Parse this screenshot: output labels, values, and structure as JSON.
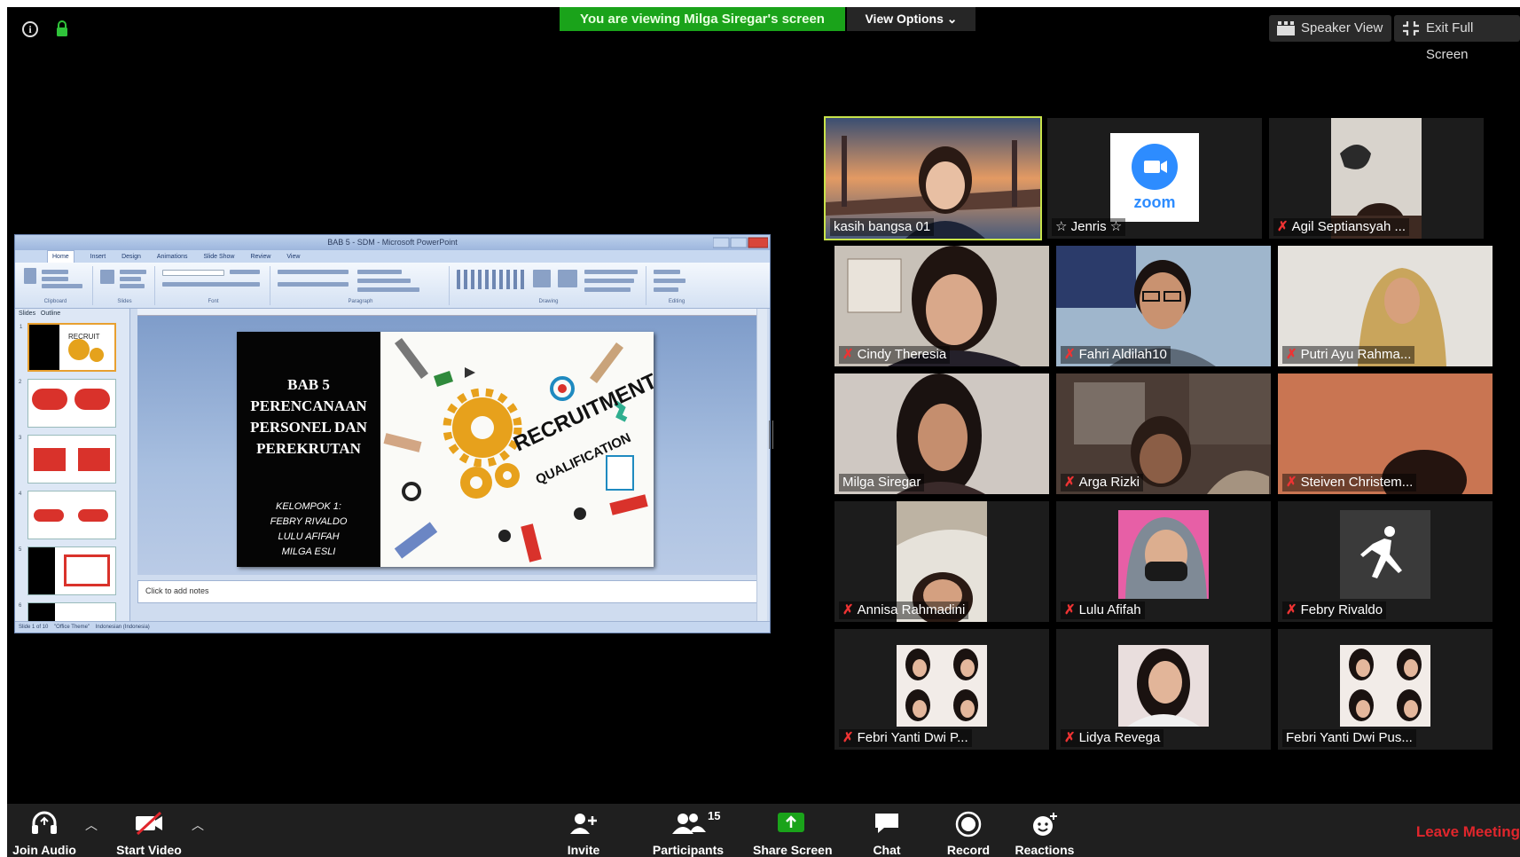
{
  "banner": {
    "viewing_text": "You are viewing Milga Siregar's screen",
    "view_options": "View Options"
  },
  "top_buttons": {
    "speaker_view": "Speaker View",
    "exit_full_screen": "Exit Full Screen"
  },
  "shared_screen": {
    "window_title": "BAB 5 - SDM - Microsoft PowerPoint",
    "ribbon_tabs": [
      "Home",
      "Insert",
      "Design",
      "Animations",
      "Slide Show",
      "Review",
      "View"
    ],
    "ribbon_groups": [
      "Clipboard",
      "Slides",
      "Font",
      "Paragraph",
      "Drawing",
      "Editing"
    ],
    "panel_tabs": [
      "Slides",
      "Outline"
    ],
    "slide": {
      "title": "BAB 5\nPERENCANAAN\nPERSONEL DAN\nPEREKRUTAN",
      "group": "KELOMPOK 1:\nFEBRY RIVALDO\nLULU AFIFAH\nMILGA ESLI",
      "art_word1": "RECRUITMENT",
      "art_word2": "QUALIFICATION"
    },
    "notes_placeholder": "Click to add notes",
    "status_bar": [
      "Slide 1 of 10",
      "\"Office Theme\"",
      "Indonesian (Indonesia)"
    ]
  },
  "participants": [
    {
      "name": "kasih bangsa 01",
      "muted": false,
      "active": true
    },
    {
      "name": "☆ Jenris ☆",
      "muted": false,
      "logo": "zoom"
    },
    {
      "name": "Agil Septiansyah ...",
      "muted": true
    },
    {
      "name": "Cindy Theresia",
      "muted": true
    },
    {
      "name": "Fahri Aldilah10",
      "muted": true
    },
    {
      "name": "Putri Ayu Rahma...",
      "muted": true
    },
    {
      "name": "Milga Siregar",
      "muted": false
    },
    {
      "name": "Arga Rizki",
      "muted": true
    },
    {
      "name": "Steiven Christem...",
      "muted": true
    },
    {
      "name": "Annisa Rahmadini",
      "muted": true
    },
    {
      "name": "Lulu Afifah",
      "muted": true
    },
    {
      "name": "Febry Rivaldo",
      "muted": true
    },
    {
      "name": "Febri Yanti Dwi P...",
      "muted": true
    },
    {
      "name": "Lidya Revega",
      "muted": true
    },
    {
      "name": "Febri Yanti Dwi Pus...",
      "muted": false
    }
  ],
  "toolbar": {
    "join_audio": "Join Audio",
    "start_video": "Start Video",
    "invite": "Invite",
    "participants": "Participants",
    "participant_count": "15",
    "share_screen": "Share Screen",
    "chat": "Chat",
    "record": "Record",
    "reactions": "Reactions",
    "leave_meeting": "Leave Meeting"
  },
  "colors": {
    "banner_green": "#1aa31a",
    "active_speaker": "#c8e34a",
    "leave_red": "#e0262c",
    "muted_red": "#e33333"
  }
}
